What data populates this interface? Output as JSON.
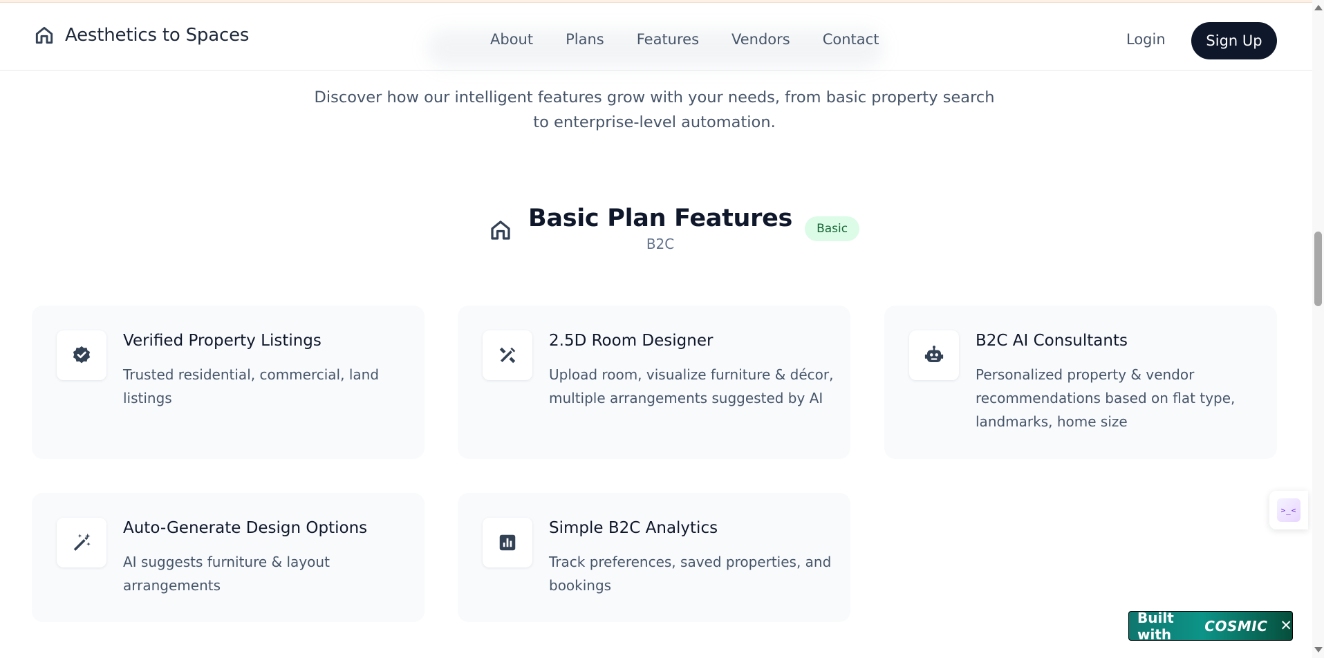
{
  "header": {
    "brand_name": "Aesthetics to Spaces",
    "nav": [
      "About",
      "Plans",
      "Features",
      "Vendors",
      "Contact"
    ],
    "login_label": "Login",
    "signup_label": "Sign Up"
  },
  "intro": {
    "text": "Discover how our intelligent features grow with your needs, from basic property search to enterprise-level automation."
  },
  "section": {
    "icon": "home-icon",
    "title": "Basic Plan Features",
    "subtitle": "B2C",
    "badge": "Basic"
  },
  "features": [
    {
      "icon": "verified-badge-icon",
      "title": "Verified Property Listings",
      "description": "Trusted residential, commercial, land listings"
    },
    {
      "icon": "design-tools-icon",
      "title": "2.5D Room Designer",
      "description": "Upload room, visualize furniture & décor, multiple arrangements suggested by AI"
    },
    {
      "icon": "robot-icon",
      "title": "B2C AI Consultants",
      "description": "Personalized property & vendor recommendations based on flat type, landmarks, home size"
    },
    {
      "icon": "magic-wand-icon",
      "title": "Auto-Generate Design Options",
      "description": "AI suggests furniture & layout arrangements"
    },
    {
      "icon": "analytics-icon",
      "title": "Simple B2C Analytics",
      "description": "Track preferences, saved properties, and bookings"
    }
  ],
  "built_badge": {
    "text": "Built with",
    "logo": "COSMIC",
    "close": "✕"
  },
  "side_widget": {
    "glyph": ">_<"
  },
  "colors": {
    "primary_dark": "#0f172a",
    "card_background": "#f8fafc",
    "badge_background": "#dcfce7",
    "badge_text": "#166534",
    "built_badge_green": "#0d9488"
  }
}
